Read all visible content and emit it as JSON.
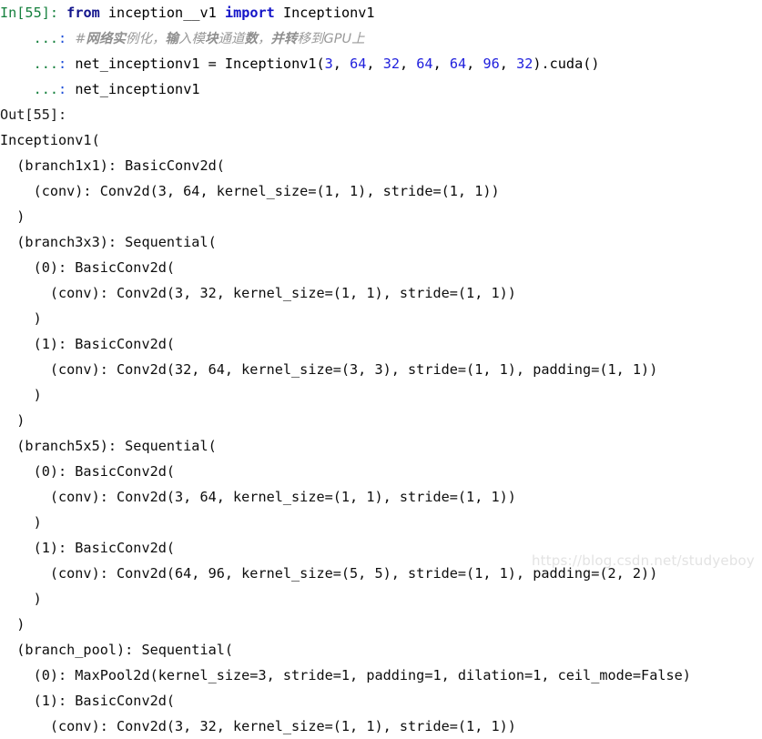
{
  "notebook": {
    "input_prompt": "In[55]:",
    "continuation_prompt": "...:",
    "output_prompt": "Out[55]:",
    "watermark": "https://blog.csdn.net/studyeboy",
    "colors": {
      "input_prompt": "#15803d",
      "continuation_dots": "#15803d",
      "continuation_colon": "#1d4ed8",
      "keyword": "#12148c",
      "keyword_import": "#1414c8",
      "number": "#2020dd",
      "comment": "#9a9a9a",
      "text": "#000000",
      "background": "#ffffff",
      "watermark": "#e3e3e3"
    }
  },
  "input_cell": {
    "line1": {
      "keyword_from": "from",
      "module": "inception__v1",
      "keyword_import": "import",
      "imported": "Inceptionv1"
    },
    "line2_comment": {
      "hash": "#",
      "seg1_bold": "网络实",
      "seg2": "例化，",
      "seg3_bold": "输",
      "seg4": "入模",
      "seg5_bold": "块",
      "seg6": "通道",
      "seg7_bold": "数",
      "seg8": "，",
      "seg9_bold": "并转",
      "seg10": "移到GPU上",
      "full_text": "#网络实例化，输入模块通道数，并转移到GPU上"
    },
    "line3": {
      "var_assign": "net_inceptionv1 = Inceptionv1(",
      "args": [
        "3",
        "64",
        "32",
        "64",
        "64",
        "96",
        "32"
      ],
      "tail": ").cuda()"
    },
    "line4": {
      "expr": "net_inceptionv1"
    }
  },
  "output_cell": {
    "lines": [
      "Inceptionv1(",
      "  (branch1x1): BasicConv2d(",
      "    (conv): Conv2d(3, 64, kernel_size=(1, 1), stride=(1, 1))",
      "  )",
      "  (branch3x3): Sequential(",
      "    (0): BasicConv2d(",
      "      (conv): Conv2d(3, 32, kernel_size=(1, 1), stride=(1, 1))",
      "    )",
      "    (1): BasicConv2d(",
      "      (conv): Conv2d(32, 64, kernel_size=(3, 3), stride=(1, 1), padding=(1, 1))",
      "    )",
      "  )",
      "  (branch5x5): Sequential(",
      "    (0): BasicConv2d(",
      "      (conv): Conv2d(3, 64, kernel_size=(1, 1), stride=(1, 1))",
      "    )",
      "    (1): BasicConv2d(",
      "      (conv): Conv2d(64, 96, kernel_size=(5, 5), stride=(1, 1), padding=(2, 2))",
      "    )",
      "  )",
      "  (branch_pool): Sequential(",
      "    (0): MaxPool2d(kernel_size=3, stride=1, padding=1, dilation=1, ceil_mode=False)",
      "    (1): BasicConv2d(",
      "      (conv): Conv2d(3, 32, kernel_size=(1, 1), stride=(1, 1))",
      "    )"
    ]
  }
}
